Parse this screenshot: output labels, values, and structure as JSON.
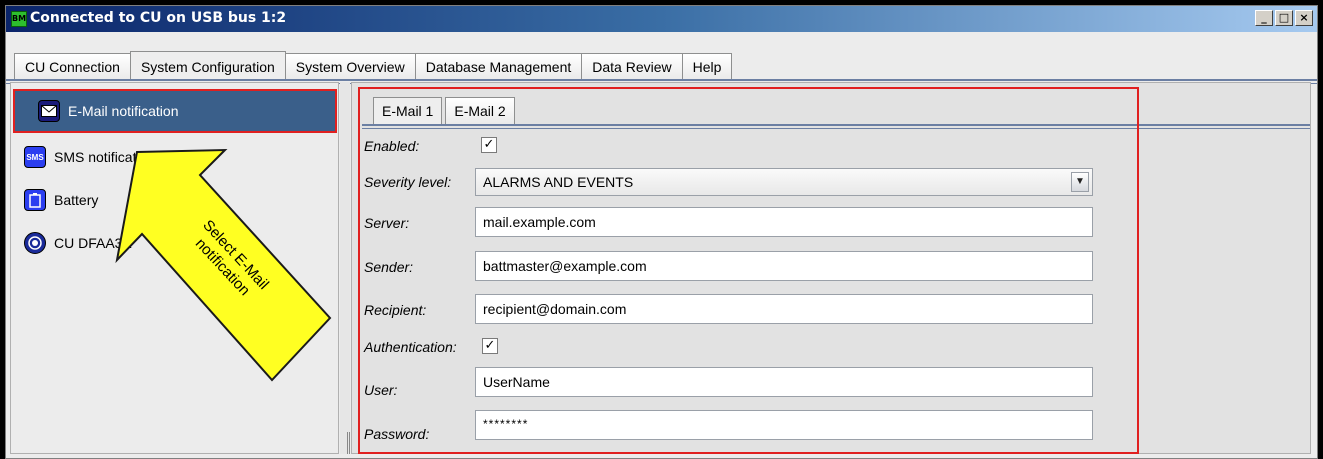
{
  "window": {
    "title": "Connected to CU on USB bus 1:2",
    "app_icon_text": "BM",
    "buttons": [
      "_",
      "□",
      "×"
    ]
  },
  "main_tabs": [
    {
      "label": "CU Connection",
      "active": false
    },
    {
      "label": "System Configuration",
      "active": true
    },
    {
      "label": "System Overview",
      "active": false
    },
    {
      "label": "Database Management",
      "active": false
    },
    {
      "label": "Data Review",
      "active": false
    },
    {
      "label": "Help",
      "active": false
    }
  ],
  "sidebar": {
    "items": [
      {
        "label": "E-Mail notification",
        "icon": "envelope-icon",
        "selected": true
      },
      {
        "label": "SMS notification",
        "icon": "sms-icon",
        "icon_text": "SMS",
        "selected": false
      },
      {
        "label": "Battery",
        "icon": "battery-icon",
        "selected": false
      },
      {
        "label": "CU DFAA3E",
        "icon": "cu-icon",
        "selected": false
      }
    ]
  },
  "email_tabs": [
    {
      "label": "E-Mail 1",
      "active": true
    },
    {
      "label": "E-Mail 2",
      "active": false
    }
  ],
  "form": {
    "enabled_label": "Enabled:",
    "enabled_checked": true,
    "severity_label": "Severity level:",
    "severity_value": "ALARMS AND EVENTS",
    "server_label": "Server:",
    "server_value": "mail.example.com",
    "sender_label": "Sender:",
    "sender_value": "battmaster@example.com",
    "recipient_label": "Recipient:",
    "recipient_value": "recipient@domain.com",
    "auth_label": "Authentication:",
    "auth_checked": true,
    "user_label": "User:",
    "user_value": "UserName",
    "password_label": "Password:",
    "password_value": "********"
  },
  "annotation": {
    "text_line1": "Select E-Mail",
    "text_line2": "notification",
    "highlight_color": "#e02020",
    "arrow_color": "#ffff22"
  },
  "colors": {
    "selected_item_bg": "#3a5f8a",
    "tab_rule": "#6b7fa3"
  }
}
